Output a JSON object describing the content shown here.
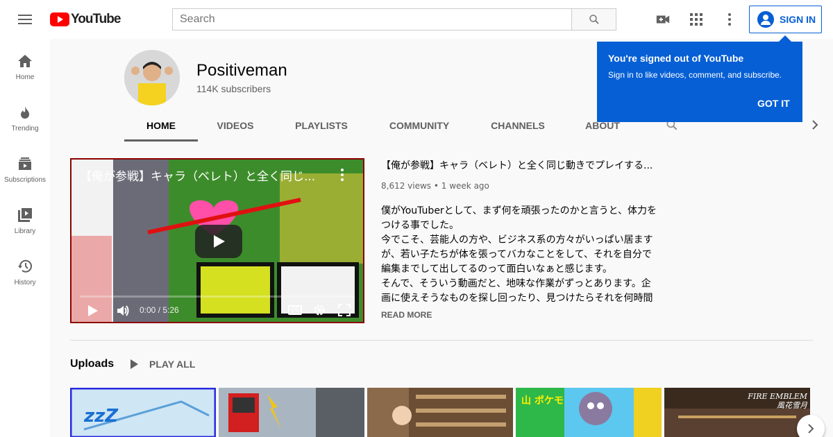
{
  "masthead": {
    "logo_text": "YouTube",
    "search_placeholder": "Search",
    "signin_label": "SIGN IN"
  },
  "guide": {
    "items": [
      {
        "label": "Home",
        "icon": "home-icon"
      },
      {
        "label": "Trending",
        "icon": "flame-icon"
      },
      {
        "label": "Subscriptions",
        "icon": "subscriptions-icon"
      },
      {
        "label": "Library",
        "icon": "library-icon"
      },
      {
        "label": "History",
        "icon": "history-icon"
      }
    ]
  },
  "channel": {
    "name": "Positiveman",
    "subscribers": "114K subscribers",
    "tabs": [
      "HOME",
      "VIDEOS",
      "PLAYLISTS",
      "COMMUNITY",
      "CHANNELS",
      "ABOUT"
    ],
    "active_tab": "HOME"
  },
  "popup": {
    "title": "You're signed out of YouTube",
    "body": "Sign in to like videos, comment, and subscribe.",
    "button": "GOT IT"
  },
  "featured": {
    "overlay_title": "【俺が参戦】キャラ（ベレト）と全く同じ...",
    "title": "【俺が参戦】キャラ（ベレト）と全く同じ動きでプレイする...",
    "views": "8,612 views",
    "age": "1 week ago",
    "time_display": "0:00 / 5:26",
    "cc_label": "CC",
    "description": [
      "僕がYouTuberとして、まず何を頑張ったのかと言うと、体力をつける事でした。",
      "今でこそ、芸能人の方や、ビジネス系の方々がいっぱい居ますが、若い子たちが体を張ってバカなことをして、それを自分で編集までして出してるのって面白いなぁと感じます。",
      "そんで、そういう動画だと、地味な作業がずっとあります。企画に使えそうなものを探し回ったり、見つけたらそれを何時間"
    ],
    "read_more": "READ MORE"
  },
  "uploads": {
    "title": "Uploads",
    "play_all": "PLAY ALL",
    "thumb_texts": [
      "zzZ",
      "",
      "",
      "山 ポケモ",
      "FIRE EMBLEM 風花雪月"
    ]
  },
  "colors": {
    "accent": "#065fd4",
    "brand": "#ff0000"
  }
}
